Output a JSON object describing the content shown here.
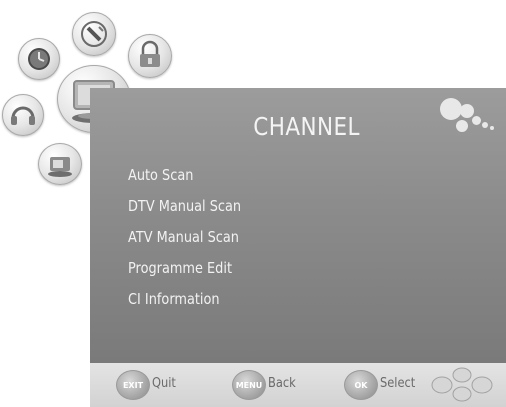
{
  "screen": {
    "title": "CHANNEL"
  },
  "menu": {
    "items": [
      {
        "label": "Auto Scan"
      },
      {
        "label": "DTV Manual Scan"
      },
      {
        "label": "ATV Manual Scan"
      },
      {
        "label": "Programme Edit"
      },
      {
        "label": "CI Information"
      }
    ]
  },
  "footer": {
    "exit": {
      "key": "EXIT",
      "label": "Quit"
    },
    "menu": {
      "key": "MENU",
      "label": "Back"
    },
    "ok": {
      "key": "OK",
      "label": "Select"
    }
  },
  "icons": {
    "top_left": "clock-icon",
    "top_center": "gauge-icon",
    "top_right": "lock-icon",
    "left": "headphones-icon",
    "active": "tv-icon",
    "bottom": "setup-icon",
    "footer_right": "navigation-pad-icon"
  }
}
